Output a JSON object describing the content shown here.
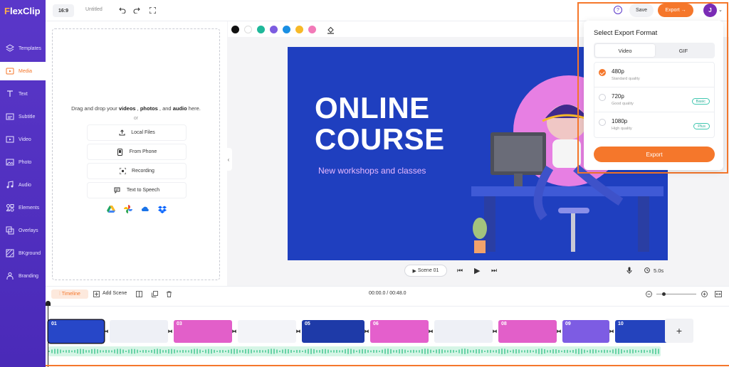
{
  "app": {
    "logo": "FlexClip"
  },
  "sidebar": {
    "items": [
      {
        "label": "Templates",
        "icon": "layers-icon"
      },
      {
        "label": "Media",
        "icon": "media-icon",
        "active": true
      },
      {
        "label": "Text",
        "icon": "text-icon"
      },
      {
        "label": "Subtitle",
        "icon": "subtitle-icon"
      },
      {
        "label": "Video",
        "icon": "video-icon"
      },
      {
        "label": "Photo",
        "icon": "photo-icon"
      },
      {
        "label": "Audio",
        "icon": "audio-icon"
      },
      {
        "label": "Elements",
        "icon": "elements-icon"
      },
      {
        "label": "Overlays",
        "icon": "overlays-icon"
      },
      {
        "label": "BKground",
        "icon": "background-icon"
      },
      {
        "label": "Branding",
        "icon": "branding-icon"
      }
    ]
  },
  "topbar": {
    "ratio": "16:9",
    "title": "Untitled",
    "save": "Save",
    "export": "Export →",
    "avatar_initial": "J"
  },
  "media": {
    "drop_prefix": "Drag and drop your ",
    "drop_videos": "videos",
    "drop_sep1": " , ",
    "drop_photos": "photos",
    "drop_sep2": " , and ",
    "drop_audio": "audio",
    "drop_suffix": " here.",
    "or": "or",
    "buttons": [
      "Local Files",
      "From Phone",
      "Recording",
      "Text to Speech"
    ]
  },
  "palette": [
    "#111111",
    "#ffffff",
    "#1fb89a",
    "#7c5ce0",
    "#1a8fe3",
    "#f7b928",
    "#f27ab8"
  ],
  "stage": {
    "title_line1": "ONLINE",
    "title_line2": "COURSE",
    "subtitle": "New workshops and classes",
    "bg": "#1f3fbf"
  },
  "player": {
    "scene": "Scene  01",
    "duration": "5.0s"
  },
  "export_panel": {
    "title": "Select Export Format",
    "tabs": [
      "Video",
      "GIF"
    ],
    "options": [
      {
        "name": "480p",
        "desc": "Standard quality",
        "badge": "",
        "selected": true
      },
      {
        "name": "720p",
        "desc": "Good quality",
        "badge": "Basic",
        "selected": false
      },
      {
        "name": "1080p",
        "desc": "High quality",
        "badge": "Plus",
        "selected": false
      }
    ],
    "export_button": "Export"
  },
  "timeline": {
    "label": "Timeline",
    "add_scene": "Add Scene",
    "time": "00:00.0 / 00:48.0",
    "clips": [
      {
        "num": "01",
        "color": "#2747c8"
      },
      {
        "num": "",
        "color": "#eef0f6"
      },
      {
        "num": "03",
        "color": "#e25fc9"
      },
      {
        "num": "",
        "color": "#f3f4f8"
      },
      {
        "num": "05",
        "color": "#1e3aa8"
      },
      {
        "num": "06",
        "color": "#e45fcc"
      },
      {
        "num": "",
        "color": "#eef0f6"
      },
      {
        "num": "08",
        "color": "#e25fc9"
      },
      {
        "num": "09",
        "color": "#7d5ce3"
      },
      {
        "num": "10",
        "color": "#2443bd"
      }
    ]
  }
}
